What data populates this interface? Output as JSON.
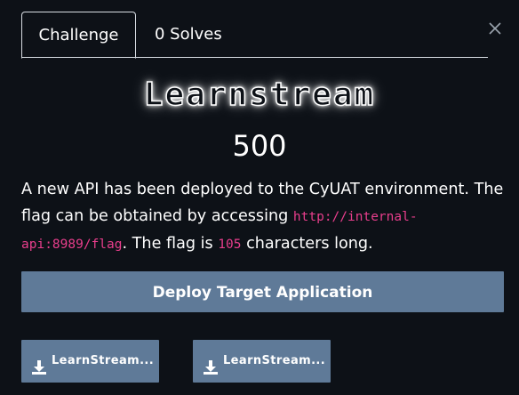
{
  "tabs": {
    "challenge": "Challenge",
    "solves": "0 Solves"
  },
  "challenge": {
    "title": "Learnstream",
    "points": "500",
    "description": {
      "part1": "A new API has been deployed to the CyUAT environment. The flag can be obtained by accessing ",
      "url": "http://internal-api:8989/flag",
      "part2": ". The flag is ",
      "length": "105",
      "part3": " characters long."
    }
  },
  "deploy_button": "Deploy Target Application",
  "files": [
    {
      "label": "LearnStream...",
      "icon": "download-icon"
    },
    {
      "label": "LearnStream...",
      "icon": "download-icon"
    }
  ],
  "colors": {
    "background": "#0d1117",
    "button": "#5f7a98",
    "code": "#e83e8c"
  }
}
